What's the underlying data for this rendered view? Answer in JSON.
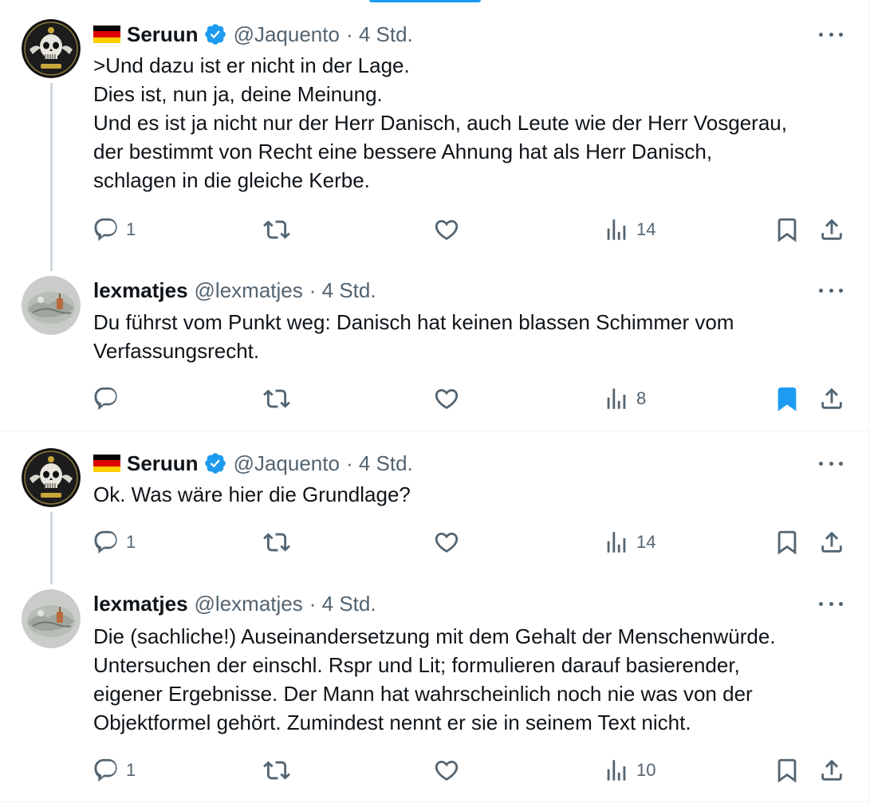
{
  "colors": {
    "accent": "#1d9bf0",
    "text": "#0f1419",
    "secondary": "#536471",
    "thread_line": "#cfd9de"
  },
  "tweets": [
    {
      "flag": "german-flag-icon",
      "name": "Seruun",
      "verified": true,
      "handle": "@Jaquento",
      "time": "· 4 Std.",
      "lines": [
        ">Und dazu ist er nicht in der Lage.",
        "Dies ist, nun ja, deine Meinung.",
        "Und es ist ja nicht nur der Herr Danisch, auch Leute wie der Herr Vosgerau,",
        "der bestimmt von Recht eine bessere Ahnung hat als Herr Danisch,",
        "schlagen in die gleiche Kerbe."
      ],
      "replies": "1",
      "retweets": "",
      "likes": "",
      "views": "14",
      "bookmarked": false
    },
    {
      "flag": "",
      "name": "lexmatjes",
      "verified": false,
      "handle": "@lexmatjes",
      "time": "· 4 Std.",
      "lines": [
        "Du führst vom Punkt weg: Danisch hat keinen blassen Schimmer vom",
        "Verfassungsrecht."
      ],
      "replies": "",
      "retweets": "",
      "likes": "",
      "views": "8",
      "bookmarked": true
    },
    {
      "flag": "german-flag-icon",
      "name": "Seruun",
      "verified": true,
      "handle": "@Jaquento",
      "time": "· 4 Std.",
      "lines": [
        "Ok. Was wäre hier die Grundlage?"
      ],
      "replies": "1",
      "retweets": "",
      "likes": "",
      "views": "14",
      "bookmarked": false
    },
    {
      "flag": "",
      "name": "lexmatjes",
      "verified": false,
      "handle": "@lexmatjes",
      "time": "· 4 Std.",
      "lines": [
        "Die (sachliche!) Auseinandersetzung mit dem Gehalt der Menschenwürde.",
        "Untersuchen der einschl. Rspr und Lit; formulieren darauf basierender,",
        "eigener Ergebnisse. Der Mann hat wahrscheinlich noch nie was von der",
        "Objektformel gehört. Zumindest nennt er sie in seinem Text nicht."
      ],
      "replies": "1",
      "retweets": "",
      "likes": "",
      "views": "10",
      "bookmarked": false
    }
  ]
}
